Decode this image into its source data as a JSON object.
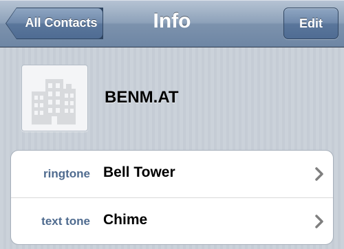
{
  "navbar": {
    "title": "Info",
    "back_label": "All Contacts",
    "edit_label": "Edit"
  },
  "contact": {
    "name": "BENM.AT",
    "photo_icon": "building-icon"
  },
  "fields": [
    {
      "label": "ringtone",
      "value": "Bell Tower",
      "icon": "chevron-right-icon"
    },
    {
      "label": "text tone",
      "value": "Chime",
      "icon": "chevron-right-icon"
    }
  ],
  "colors": {
    "nav_bar": "#7c92ad",
    "field_label": "#4f6b8f",
    "background": "#c8cfd8"
  }
}
